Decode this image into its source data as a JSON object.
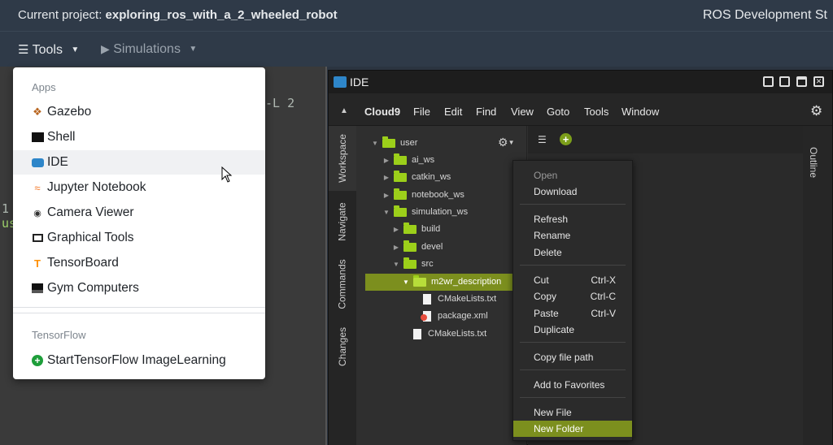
{
  "topbar": {
    "project_label": "Current project:",
    "project_name": "exploring_ros_with_a_2_wheeled_robot",
    "brand": "ROS Development St"
  },
  "toolbar": {
    "tools_label": "Tools",
    "simulations_label": "Simulations"
  },
  "terminal": {
    "line1": "-L 2",
    "line2": "1",
    "line3": "us"
  },
  "tools_menu": {
    "apps_header": "Apps",
    "apps": [
      {
        "label": "Gazebo",
        "icon": "gazebo-icon"
      },
      {
        "label": "Shell",
        "icon": "terminal-icon"
      },
      {
        "label": "IDE",
        "icon": "ide-icon"
      },
      {
        "label": "Jupyter Notebook",
        "icon": "jupyter-icon"
      },
      {
        "label": "Camera Viewer",
        "icon": "camera-icon"
      },
      {
        "label": "Graphical Tools",
        "icon": "monitor-icon"
      },
      {
        "label": "TensorBoard",
        "icon": "tensorflow-icon"
      },
      {
        "label": "Gym Computers",
        "icon": "server-icon"
      }
    ],
    "tensorflow_header": "TensorFlow",
    "tensorflow_items": [
      {
        "label": "StartTensorFlow ImageLearning",
        "icon": "plus-circle-icon"
      }
    ]
  },
  "ide": {
    "title": "IDE",
    "menu": [
      "Cloud9",
      "File",
      "Edit",
      "Find",
      "View",
      "Goto",
      "Tools",
      "Window"
    ],
    "side_tabs": [
      "Workspace",
      "Navigate",
      "Commands",
      "Changes"
    ],
    "outline_tab": "Outline",
    "tree": [
      {
        "label": "user",
        "type": "folder",
        "depth": 0,
        "open": true
      },
      {
        "label": "ai_ws",
        "type": "folder",
        "depth": 1,
        "open": false
      },
      {
        "label": "catkin_ws",
        "type": "folder",
        "depth": 1,
        "open": false
      },
      {
        "label": "notebook_ws",
        "type": "folder",
        "depth": 1,
        "open": false
      },
      {
        "label": "simulation_ws",
        "type": "folder",
        "depth": 1,
        "open": true
      },
      {
        "label": "build",
        "type": "folder",
        "depth": 2,
        "open": false
      },
      {
        "label": "devel",
        "type": "folder",
        "depth": 2,
        "open": false
      },
      {
        "label": "src",
        "type": "folder",
        "depth": 2,
        "open": true
      },
      {
        "label": "m2wr_description",
        "type": "folder",
        "depth": 3,
        "open": true,
        "selected": true
      },
      {
        "label": "CMakeLists.txt",
        "type": "file",
        "depth": 4
      },
      {
        "label": "package.xml",
        "type": "xml",
        "depth": 4
      },
      {
        "label": "CMakeLists.txt",
        "type": "file",
        "depth": 3
      }
    ]
  },
  "context_menu": {
    "items": [
      {
        "label": "Open",
        "disabled": true
      },
      {
        "label": "Download"
      },
      {
        "sep": true
      },
      {
        "label": "Refresh"
      },
      {
        "label": "Rename"
      },
      {
        "label": "Delete"
      },
      {
        "sep": true
      },
      {
        "label": "Cut",
        "shortcut": "Ctrl-X"
      },
      {
        "label": "Copy",
        "shortcut": "Ctrl-C"
      },
      {
        "label": "Paste",
        "shortcut": "Ctrl-V"
      },
      {
        "label": "Duplicate"
      },
      {
        "sep": true
      },
      {
        "label": "Copy file path"
      },
      {
        "sep": true
      },
      {
        "label": "Add to Favorites"
      },
      {
        "sep": true
      },
      {
        "label": "New File"
      },
      {
        "label": "New Folder",
        "active": true
      }
    ]
  },
  "colors": {
    "accent_green": "#7c8f1e",
    "folder_green": "#9ccf1a",
    "topbar": "#2f3a48"
  }
}
